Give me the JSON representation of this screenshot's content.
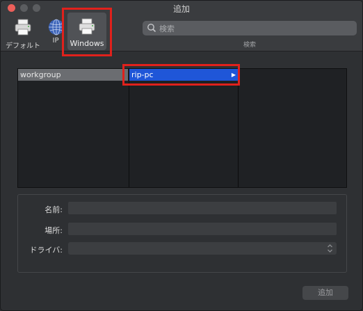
{
  "window": {
    "title": "追加"
  },
  "toolbar": {
    "default_label": "デフォルト",
    "ip_label": "IP",
    "windows_label": "Windows"
  },
  "search": {
    "placeholder": "検索",
    "label": "検索"
  },
  "browser": {
    "col1": [
      "workgroup"
    ],
    "col2": [
      "rip-pc"
    ]
  },
  "form": {
    "name_label": "名前:",
    "location_label": "場所:",
    "driver_label": "ドライバ:"
  },
  "footer": {
    "add_label": "追加"
  },
  "colors": {
    "highlight": "#e0211c",
    "selection": "#1f56d8"
  }
}
